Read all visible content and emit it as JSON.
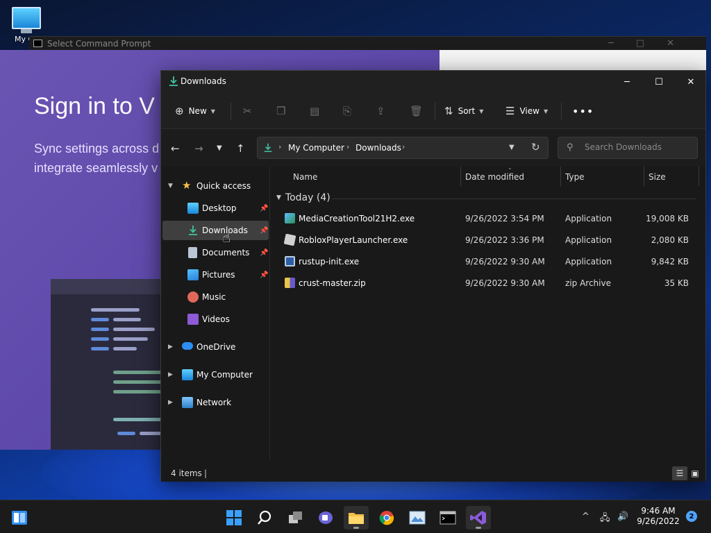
{
  "desktop": {
    "icon_label": "My Co"
  },
  "cmd_window": {
    "title": "Select Command Prompt"
  },
  "signin_page": {
    "heading": "Sign in to V",
    "sub_line1": "Sync settings across d",
    "sub_line2": "integrate seamlessly v"
  },
  "explorer": {
    "title": "Downloads",
    "toolbar": {
      "new_label": "New",
      "sort_label": "Sort",
      "view_label": "View"
    },
    "address": {
      "crumb1": "My Computer",
      "crumb2": "Downloads"
    },
    "search": {
      "placeholder": "Search Downloads"
    },
    "sidebar": {
      "quick_access": "Quick access",
      "desktop": "Desktop",
      "downloads": "Downloads",
      "documents": "Documents",
      "pictures": "Pictures",
      "music": "Music",
      "videos": "Videos",
      "onedrive": "OneDrive",
      "my_computer": "My Computer",
      "network": "Network"
    },
    "columns": {
      "name": "Name",
      "date": "Date modified",
      "type": "Type",
      "size": "Size"
    },
    "group_label": "Today (4)",
    "files": [
      {
        "name": "MediaCreationTool21H2.exe",
        "date": "9/26/2022 3:54 PM",
        "type": "Application",
        "size": "19,008 KB"
      },
      {
        "name": "RobloxPlayerLauncher.exe",
        "date": "9/26/2022 3:36 PM",
        "type": "Application",
        "size": "2,080 KB"
      },
      {
        "name": "rustup-init.exe",
        "date": "9/26/2022 9:30 AM",
        "type": "Application",
        "size": "9,842 KB"
      },
      {
        "name": "crust-master.zip",
        "date": "9/26/2022 9:30 AM",
        "type": "zip Archive",
        "size": "35 KB"
      }
    ],
    "status": {
      "count": "4 items"
    }
  },
  "taskbar": {
    "time": "9:46 AM",
    "date": "9/26/2022",
    "notification_count": "2"
  },
  "colors": {
    "accent": "#4fa3ff",
    "explorer_bg": "#191919",
    "signin_purple": "#5a46a8"
  }
}
